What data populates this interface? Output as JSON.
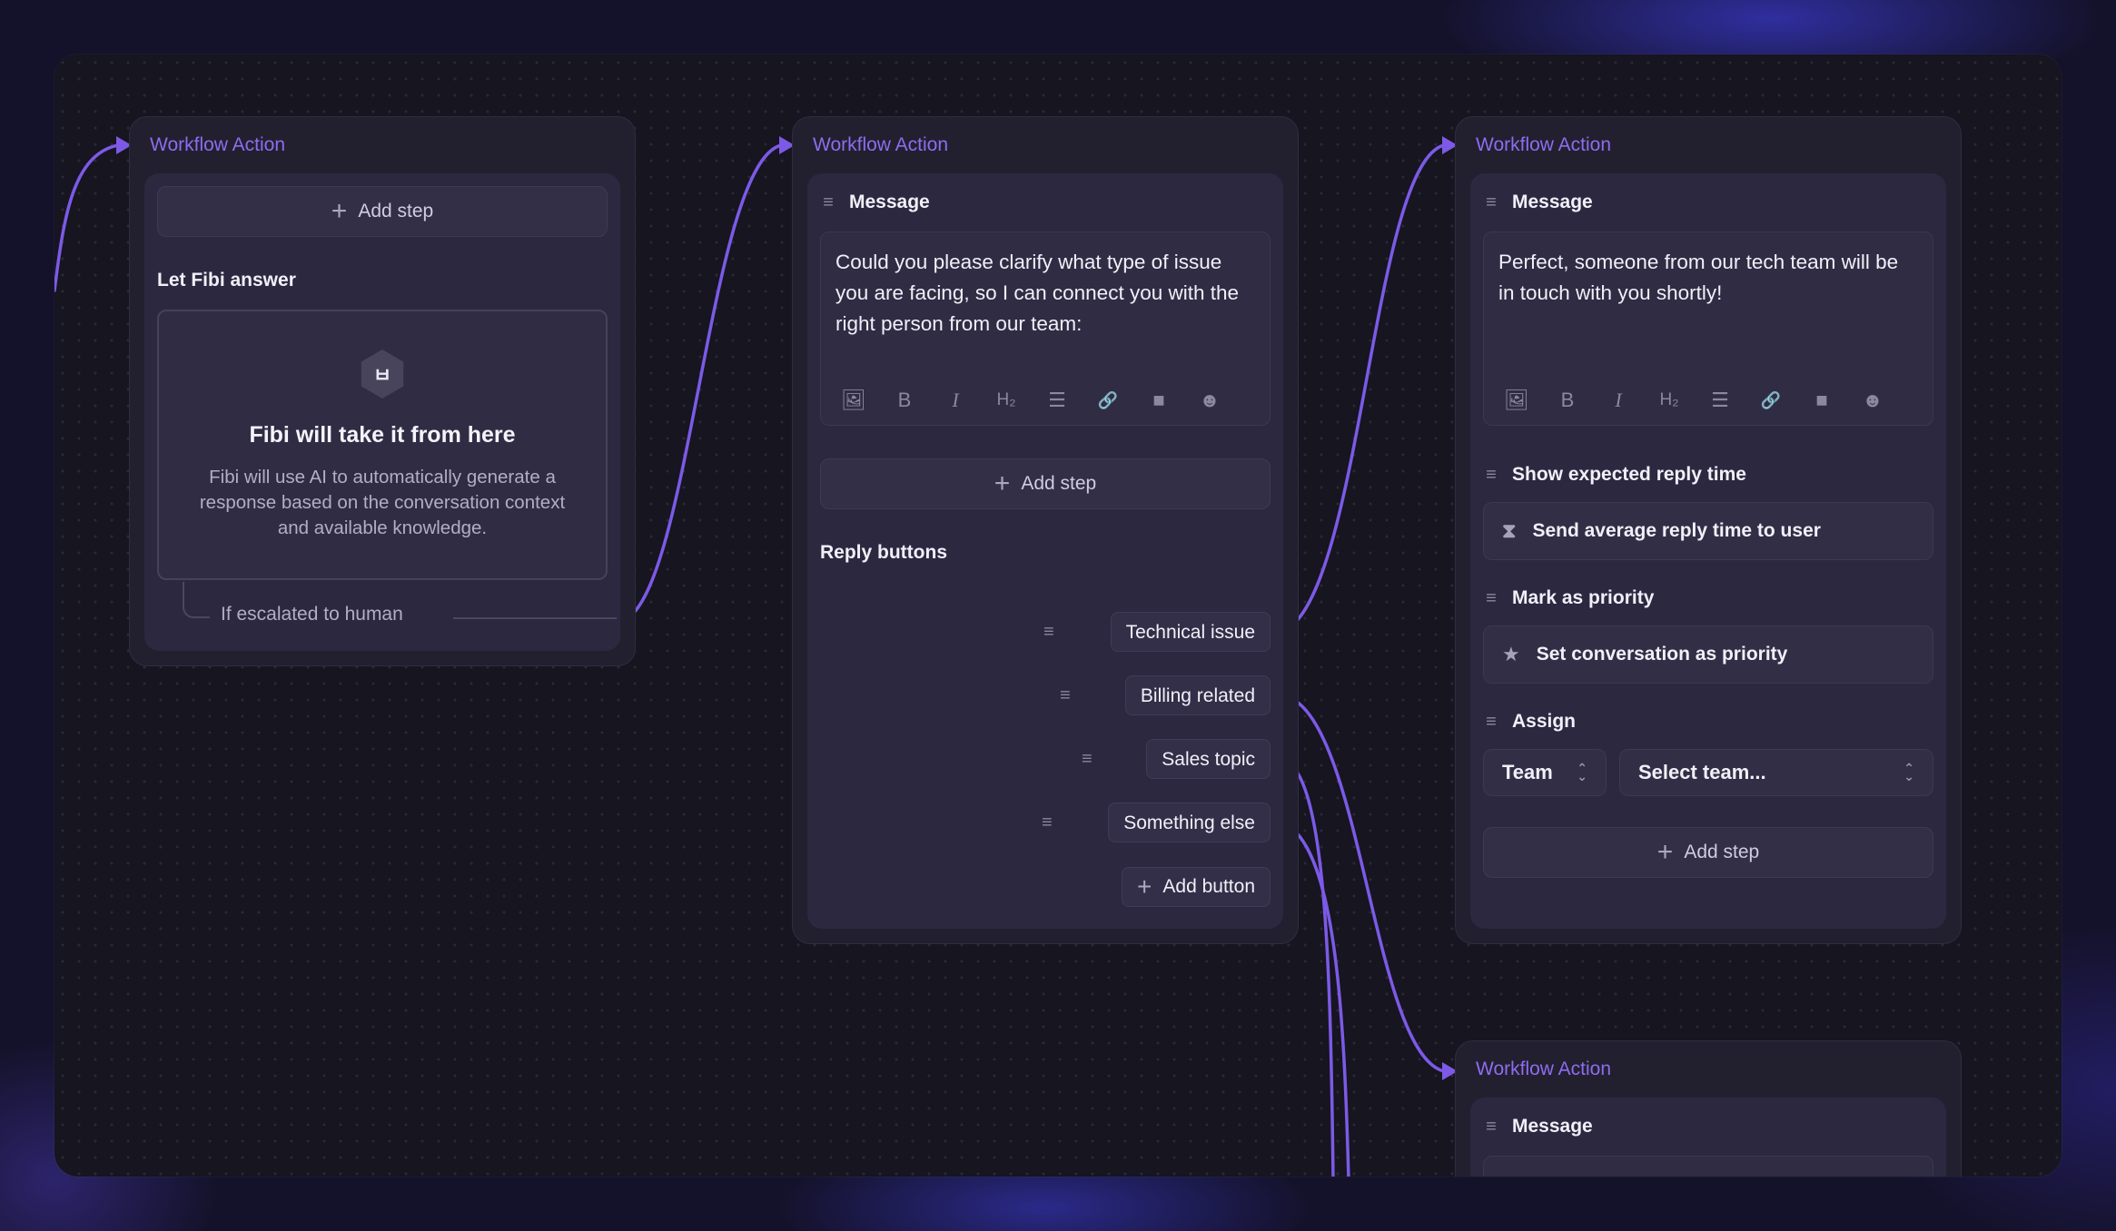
{
  "colors": {
    "accent": "#8e6cf0",
    "wire": "#7c5ae6"
  },
  "nodes": {
    "ai": {
      "title": "Workflow Action",
      "add_step": "Add step",
      "section": "Let Fibi answer",
      "card_title": "Fibi will take it from here",
      "card_body": "Fibi will use AI to automatically generate a response based on the conversation context and available knowledge.",
      "escalate": "If escalated to human"
    },
    "clarify": {
      "title": "Workflow Action",
      "section": "Message",
      "message": "Could you please clarify what type of issue you are facing, so I can connect you with the right person from our team:",
      "add_step": "Add step",
      "reply_label": "Reply buttons",
      "replies": [
        "Technical issue",
        "Billing related",
        "Sales topic",
        "Something else"
      ],
      "add_button": "Add button"
    },
    "tech": {
      "title": "Workflow Action",
      "section": "Message",
      "message": "Perfect, someone from our tech team will be in touch with you shortly!",
      "reply_time_label": "Show expected reply time",
      "reply_time_value": "Send average reply time to user",
      "priority_label": "Mark as priority",
      "priority_value": "Set conversation as priority",
      "assign_label": "Assign",
      "assign_type": "Team",
      "assign_team_placeholder": "Select team...",
      "add_step": "Add step"
    },
    "next": {
      "title": "Workflow Action",
      "section": "Message"
    }
  },
  "toolbar": {
    "image": "🖼",
    "bold": "B",
    "italic": "I",
    "heading": "H₂",
    "list": "☰",
    "link": "🔗",
    "video": "■",
    "emoji": "☻"
  },
  "icons": {
    "grip": "≡",
    "plus": "+",
    "hourglass": "⧗",
    "star": "★",
    "face": "ㅂ"
  }
}
